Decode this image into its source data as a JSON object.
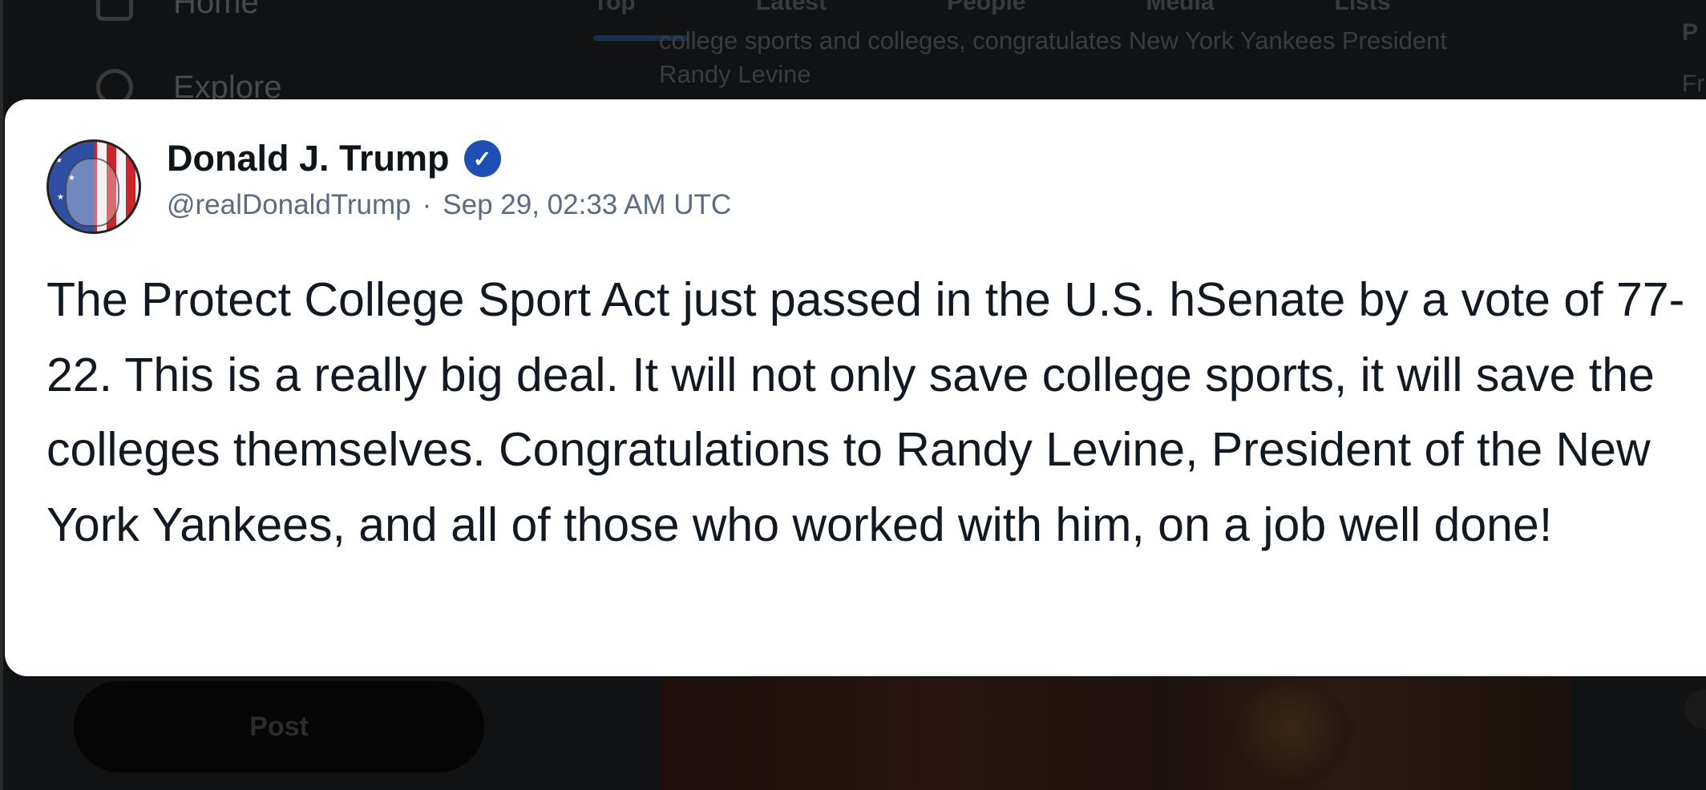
{
  "background": {
    "nav": [
      "Home",
      "Explore"
    ],
    "tabs": [
      "Top",
      "Latest",
      "People",
      "Media",
      "Lists"
    ],
    "result_snippet_line1": "college sports and colleges, congratulates New York Yankees President",
    "result_snippet_line2": "Randy Levine",
    "right_fragment_1": "P",
    "right_fragment_2": "Fr",
    "post_button": "Post"
  },
  "post": {
    "author_name": "Donald J. Trump",
    "verified_badge": "✓",
    "handle": "@realDonaldTrump",
    "separator": "·",
    "timestamp": "Sep 29, 02:33 AM UTC",
    "text": "The Protect College Sport Act just passed in the U.S. hSenate by a vote of 77-22. This is a really big deal. It will not only save college sports, it will save the colleges themselves. Congratulations to Randy Levine, President of the New York Yankees, and all of those who worked with him, on a job well done!"
  },
  "colors": {
    "card_bg": "#ffffff",
    "overlay_bg": "#111213",
    "verified_blue": "#1f4fb4",
    "meta_gray": "#5b6b80",
    "text_dark": "#131920"
  }
}
